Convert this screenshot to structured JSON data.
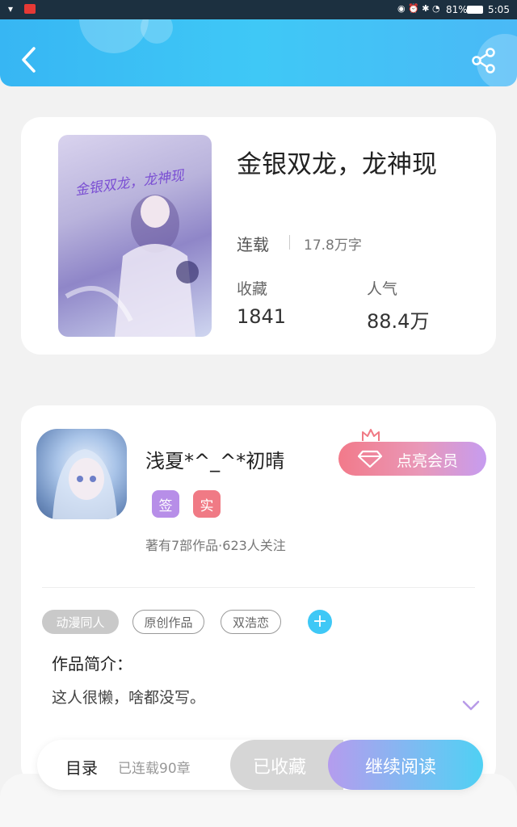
{
  "status_bar": {
    "battery": "81%",
    "time": "5:05"
  },
  "book": {
    "title": "金银双龙，龙神现",
    "cover_text": "金银双龙，龙神现",
    "status": "连载",
    "word_count": "17.8万字",
    "favorites_label": "收藏",
    "favorites_value": "1841",
    "popularity_label": "人气",
    "popularity_value": "88.4万"
  },
  "author": {
    "name": "浅夏*^_^*初晴",
    "badge_sign": "签",
    "badge_real": "实",
    "stats": "著有7部作品·623人关注",
    "vip_button": "点亮会员"
  },
  "tags": [
    "动漫同人",
    "原创作品",
    "双浩恋"
  ],
  "intro": {
    "heading": "作品简介：",
    "text": "这人很懒，啥都没写。"
  },
  "bottom_bar": {
    "catalog": "目录",
    "chapters": "已连载90章",
    "collected": "已收藏",
    "continue": "继续阅读"
  },
  "colors": {
    "accent_blue": "#3fc8f6",
    "sign_badge": "#b78ee8",
    "real_badge": "#f07a85"
  }
}
